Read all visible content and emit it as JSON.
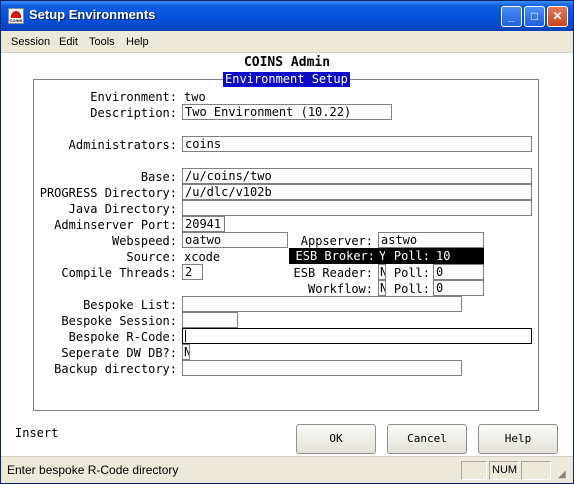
{
  "window": {
    "title": "Setup Environments"
  },
  "title_buttons": {
    "minimize": "_",
    "maximize": "□",
    "close": "✕"
  },
  "menu": [
    "Session",
    "Edit",
    "Tools",
    "Help"
  ],
  "app_title": "COINS Admin",
  "frame_title": "Environment Setup",
  "fields": {
    "environment": {
      "label": "Environment:",
      "value": "two"
    },
    "description": {
      "label": "Description:",
      "value": "Two Environment (10.22)"
    },
    "administrators": {
      "label": "Administrators:",
      "value": "coins"
    },
    "base": {
      "label": "Base:",
      "value": "/u/coins/two"
    },
    "progress_directory": {
      "label": "PROGRESS Directory:",
      "value": "/u/dlc/v102b"
    },
    "java_directory": {
      "label": "Java Directory:",
      "value": ""
    },
    "adminserver_port": {
      "label": "Adminserver Port:",
      "value": "20941"
    },
    "webspeed": {
      "label": "Webspeed:",
      "value": "oatwo"
    },
    "appserver": {
      "label": "Appserver:",
      "value": "astwo"
    },
    "source": {
      "label": "Source:",
      "value": "xcode"
    },
    "esb_broker": {
      "label": "ESB Broker:",
      "value": "Y",
      "poll_label": "Poll:",
      "poll_value": "10"
    },
    "compile_threads": {
      "label": "Compile Threads:",
      "value": "2"
    },
    "esb_reader": {
      "label": "ESB Reader:",
      "value": "N",
      "poll_label": "Poll:",
      "poll_value": "0"
    },
    "workflow": {
      "label": "Workflow:",
      "value": "N",
      "poll_label": "Poll:",
      "poll_value": "0"
    },
    "bespoke_list": {
      "label": "Bespoke List:",
      "value": ""
    },
    "bespoke_session": {
      "label": "Bespoke Session:",
      "value": ""
    },
    "bespoke_rcode": {
      "label": "Bespoke R-Code:",
      "value": ""
    },
    "seperate_dw_db": {
      "label": "Seperate DW DB?:",
      "value": "N"
    },
    "backup_directory": {
      "label": "Backup directory:",
      "value": ""
    }
  },
  "mode": "Insert",
  "buttons": {
    "ok": "OK",
    "cancel": "Cancel",
    "help": "Help"
  },
  "status": {
    "message": "Enter bespoke R-Code directory",
    "num": "NUM"
  }
}
